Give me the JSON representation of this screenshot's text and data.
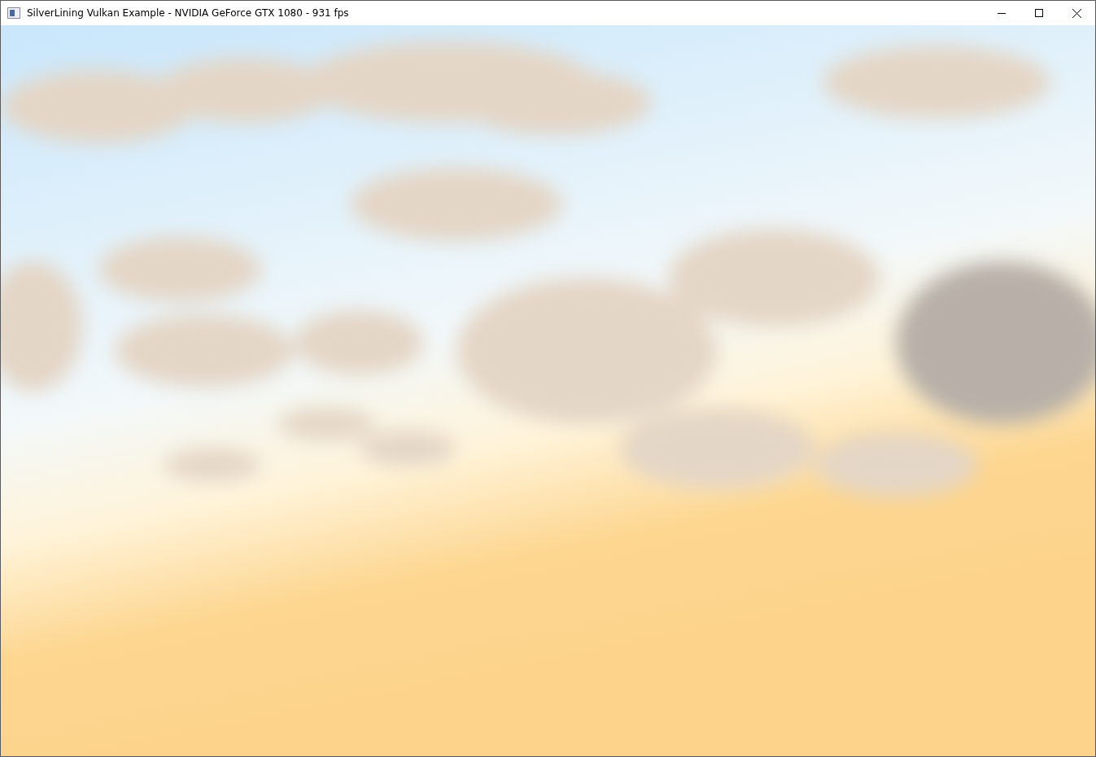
{
  "window": {
    "title": "SilverLining Vulkan Example - NVIDIA GeForce GTX 1080 - 931 fps"
  },
  "controls": [
    {
      "kind": "minimize"
    },
    {
      "kind": "maximize"
    },
    {
      "kind": "close"
    }
  ]
}
